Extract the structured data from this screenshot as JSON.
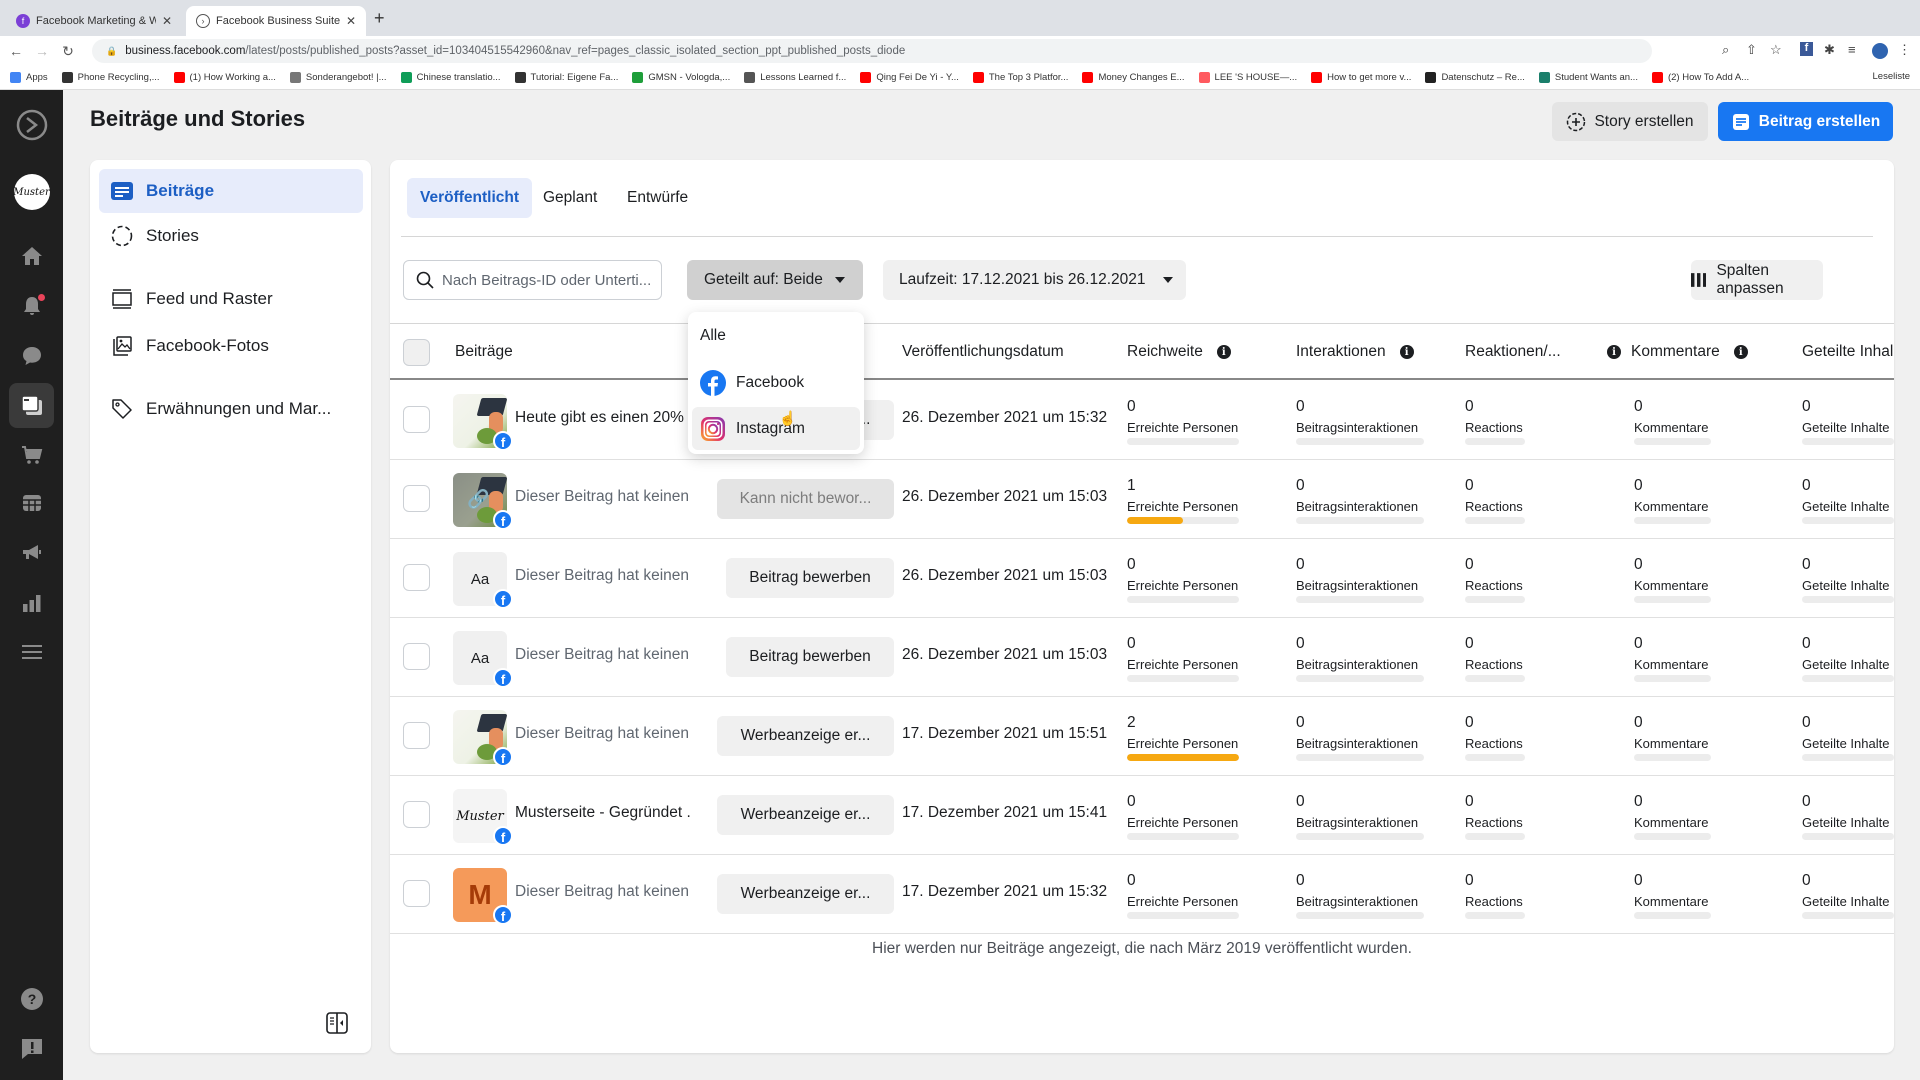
{
  "browser": {
    "tabs": [
      {
        "title": "Facebook Marketing & Werbea",
        "active": false
      },
      {
        "title": "Facebook Business Suite",
        "active": true
      }
    ],
    "url_host": "business.facebook.com",
    "url_path": "/latest/posts/published_posts?asset_id=103404515542960&nav_ref=pages_classic_isolated_section_ppt_published_posts_diode",
    "bookmarks": [
      {
        "label": "Apps",
        "color": "#4285f4"
      },
      {
        "label": "Phone Recycling,...",
        "color": "#333333"
      },
      {
        "label": "(1) How Working a...",
        "color": "#ff0000"
      },
      {
        "label": "Sonderangebot! |...",
        "color": "#777777"
      },
      {
        "label": "Chinese translatio...",
        "color": "#0f9d58"
      },
      {
        "label": "Tutorial: Eigene Fa...",
        "color": "#333333"
      },
      {
        "label": "GMSN - Vologda,...",
        "color": "#1e9e3a"
      },
      {
        "label": "Lessons Learned f...",
        "color": "#555555"
      },
      {
        "label": "Qing Fei De Yi - Y...",
        "color": "#ff0000"
      },
      {
        "label": "The Top 3 Platfor...",
        "color": "#ff0000"
      },
      {
        "label": "Money Changes E...",
        "color": "#ff0000"
      },
      {
        "label": "LEE 'S HOUSE—...",
        "color": "#ff5a5f"
      },
      {
        "label": "How to get more v...",
        "color": "#ff0000"
      },
      {
        "label": "Datenschutz – Re...",
        "color": "#222222"
      },
      {
        "label": "Student Wants an...",
        "color": "#1b7f6b"
      },
      {
        "label": "(2) How To Add A...",
        "color": "#ff0000"
      }
    ],
    "reading_list": "Leseliste"
  },
  "header": {
    "title": "Beiträge und Stories",
    "story_button": "Story erstellen",
    "post_button": "Beitrag erstellen"
  },
  "sidebar": {
    "items": [
      {
        "label": "Beiträge",
        "icon": "posts-icon",
        "active": true
      },
      {
        "label": "Stories",
        "icon": "stories-icon",
        "active": false
      },
      {
        "label": "Feed und Raster",
        "icon": "feed-grid-icon",
        "active": false
      },
      {
        "label": "Facebook-Fotos",
        "icon": "photos-icon",
        "active": false
      },
      {
        "label": "Erwähnungen und Mar...",
        "icon": "tag-icon",
        "active": false
      }
    ]
  },
  "main": {
    "tabs": [
      {
        "label": "Veröffentlicht",
        "active": true
      },
      {
        "label": "Geplant",
        "active": false
      },
      {
        "label": "Entwürfe",
        "active": false
      }
    ],
    "search_placeholder": "Nach Beitrags-ID oder Unterti...",
    "filter_shared": "Geteilt auf: Beide",
    "filter_date": "Laufzeit: 17.12.2021 bis 26.12.2021",
    "columns_button": "Spalten anpassen",
    "dropdown": {
      "options": [
        "Alle",
        "Facebook",
        "Instagram"
      ],
      "hovered": "Instagram"
    },
    "columns": [
      "Beiträge",
      "Veröffentlichungsdatum",
      "Reichweite",
      "Interaktionen",
      "Reaktionen/...",
      "Kommentare",
      "Geteilte Inhal"
    ],
    "metric_labels": [
      "Erreichte Personen",
      "Beitragsinteraktionen",
      "Reactions",
      "Kommentare",
      "Geteilte Inhalte"
    ],
    "rows": [
      {
        "text": "Heute gibt es einen 20%",
        "thumb": "image",
        "button": "Werbeanzeige er...",
        "button_disabled": false,
        "date": "26. Dezember 2021 um 15:32",
        "reach": "0",
        "reach_fraction": 0,
        "interactions": "0",
        "reactions": "0",
        "comments": "0",
        "shares": "0"
      },
      {
        "text": "Dieser Beitrag hat keinen ...",
        "thumb": "link-image",
        "button": "Kann nicht bewor...",
        "button_disabled": true,
        "date": "26. Dezember 2021 um 15:03",
        "reach": "1",
        "reach_fraction": 0.5,
        "interactions": "0",
        "reactions": "0",
        "comments": "0",
        "shares": "0"
      },
      {
        "text": "Dieser Beitrag hat keinen T...",
        "thumb": "Aa",
        "button": "Beitrag bewerben",
        "button_disabled": false,
        "date": "26. Dezember 2021 um 15:03",
        "reach": "0",
        "reach_fraction": 0,
        "interactions": "0",
        "reactions": "0",
        "comments": "0",
        "shares": "0"
      },
      {
        "text": "Dieser Beitrag hat keinen T...",
        "thumb": "Aa",
        "button": "Beitrag bewerben",
        "button_disabled": false,
        "date": "26. Dezember 2021 um 15:03",
        "reach": "0",
        "reach_fraction": 0,
        "interactions": "0",
        "reactions": "0",
        "comments": "0",
        "shares": "0"
      },
      {
        "text": "Dieser Beitrag hat keinen ...",
        "thumb": "image",
        "button": "Werbeanzeige er...",
        "button_disabled": false,
        "date": "17. Dezember 2021 um 15:51",
        "reach": "2",
        "reach_fraction": 1.0,
        "interactions": "0",
        "reactions": "0",
        "comments": "0",
        "shares": "0"
      },
      {
        "text": "Musterseite - Gegründet ...",
        "thumb": "Muster",
        "button": "Werbeanzeige er...",
        "button_disabled": false,
        "date": "17. Dezember 2021 um 15:41",
        "reach": "0",
        "reach_fraction": 0,
        "interactions": "0",
        "reactions": "0",
        "comments": "0",
        "shares": "0"
      },
      {
        "text": "Dieser Beitrag hat keinen ...",
        "thumb": "M",
        "button": "Werbeanzeige er...",
        "button_disabled": false,
        "date": "17. Dezember 2021 um 15:32",
        "reach": "0",
        "reach_fraction": 0,
        "interactions": "0",
        "reactions": "0",
        "comments": "0",
        "shares": "0"
      }
    ],
    "footnote": "Hier werden nur Beiträge angezeigt, die nach März 2019 veröffentlicht wurden."
  },
  "colors": {
    "brand_blue": "#1877f2",
    "active_text": "#1d5fc4",
    "reach_bar": "#f6a811",
    "rail_bg": "#1f1f1f"
  }
}
